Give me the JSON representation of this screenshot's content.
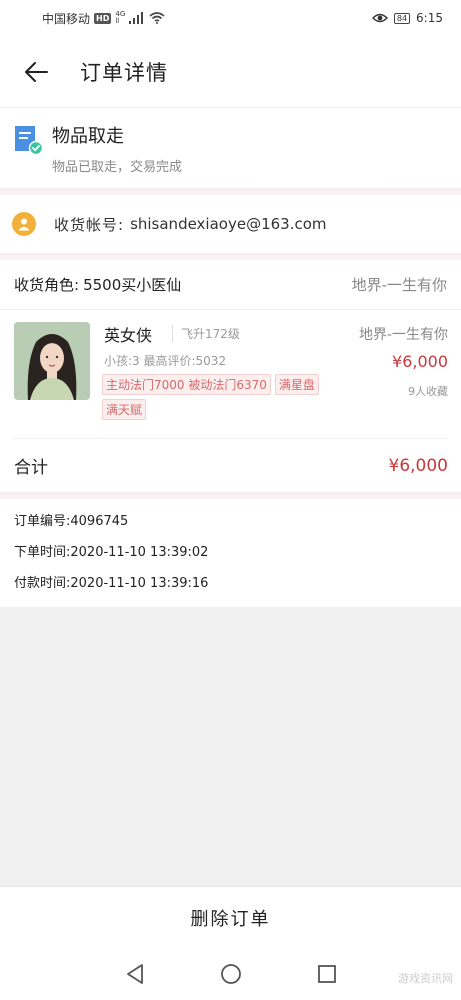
{
  "status_bar": {
    "carrier": "中国移动",
    "hd": "HD",
    "net_top": "4G",
    "net_bottom": "ll",
    "battery": "84",
    "time": "6:15"
  },
  "header": {
    "title": "订单详情",
    "back_icon": "arrow-left-icon"
  },
  "order_status": {
    "title": "物品取走",
    "subtitle": "物品已取走，交易完成",
    "icon": "document-check-icon"
  },
  "account": {
    "label": "收货帐号:",
    "value": "shisandexiaoye@163.com",
    "icon": "user-icon"
  },
  "role": {
    "label": "收货角色:",
    "value": "5500买小医仙",
    "server": "地界-一生有你"
  },
  "item": {
    "name": "英女侠",
    "level": "飞升172级",
    "stats": "小孩:3 最高评价:5032",
    "tags": [
      "主动法门7000 被动法门6370",
      "满星盘",
      "满天赋"
    ],
    "server": "地界-一生有你",
    "price": "¥6,000",
    "favorites": "9人收藏"
  },
  "total": {
    "label": "合计",
    "value": "¥6,000"
  },
  "info": {
    "order_no": "订单编号:4096745",
    "order_time": "下单时间:2020-11-10 13:39:02",
    "pay_time": "付款时间:2020-11-10 13:39:16"
  },
  "footer": {
    "delete_label": "删除订单"
  },
  "watermark": "游戏资讯网",
  "colors": {
    "price": "#c8383e",
    "tag_text": "#d86a6a",
    "status_icon": "#4a90e2",
    "account_icon": "#f2b13b"
  }
}
